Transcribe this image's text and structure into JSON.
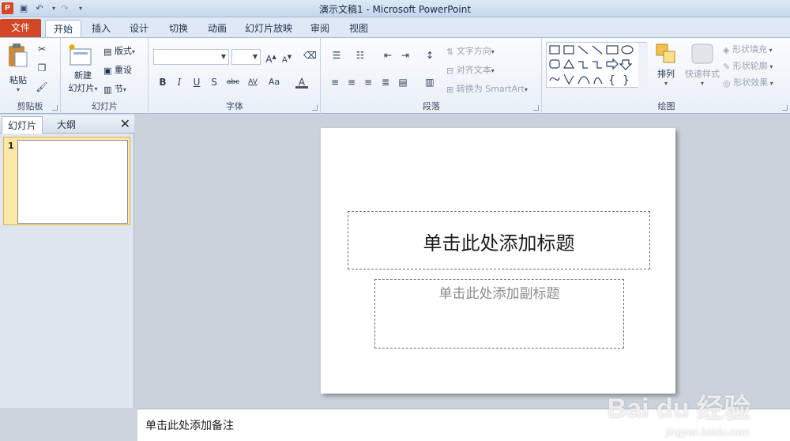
{
  "window": {
    "title": "演示文稿1 - Microsoft PowerPoint",
    "app_icon_letter": "P"
  },
  "tabs": {
    "file": "文件",
    "items": [
      "开始",
      "插入",
      "设计",
      "切换",
      "动画",
      "幻灯片放映",
      "审阅",
      "视图"
    ]
  },
  "ribbon": {
    "clipboard": {
      "label": "剪贴板",
      "paste": "粘贴"
    },
    "slides": {
      "label": "幻灯片",
      "new_slide": "新建",
      "new_slide2": "幻灯片",
      "layout": "版式",
      "reset": "重设",
      "section": "节"
    },
    "font": {
      "label": "字体",
      "font_name": "",
      "font_size": "",
      "bold": "B",
      "italic": "I",
      "underline": "U",
      "shadow": "S",
      "strike": "abc",
      "spacing": "AV",
      "case": "Aa",
      "color": "A"
    },
    "paragraph": {
      "label": "段落",
      "text_direction": "文字方向",
      "align_text": "对齐文本",
      "convert_smartart": "转换为 SmartArt"
    },
    "drawing": {
      "label": "绘图",
      "arrange": "排列",
      "quick_styles": "快速样式",
      "shape_fill": "形状填充",
      "shape_outline": "形状轮廓",
      "shape_effects": "形状效果"
    }
  },
  "panel": {
    "tab_slides": "幻灯片",
    "tab_outline": "大纲",
    "slide_number": "1"
  },
  "slide": {
    "title_placeholder": "单击此处添加标题",
    "subtitle_placeholder": "单击此处添加副标题"
  },
  "notes": {
    "placeholder": "单击此处添加备注"
  },
  "watermark": {
    "brand": "Bai du 经验",
    "url": "jingyan.baidu.com"
  },
  "colors": {
    "file_tab": "#d24726",
    "accent": "#2b579a"
  }
}
